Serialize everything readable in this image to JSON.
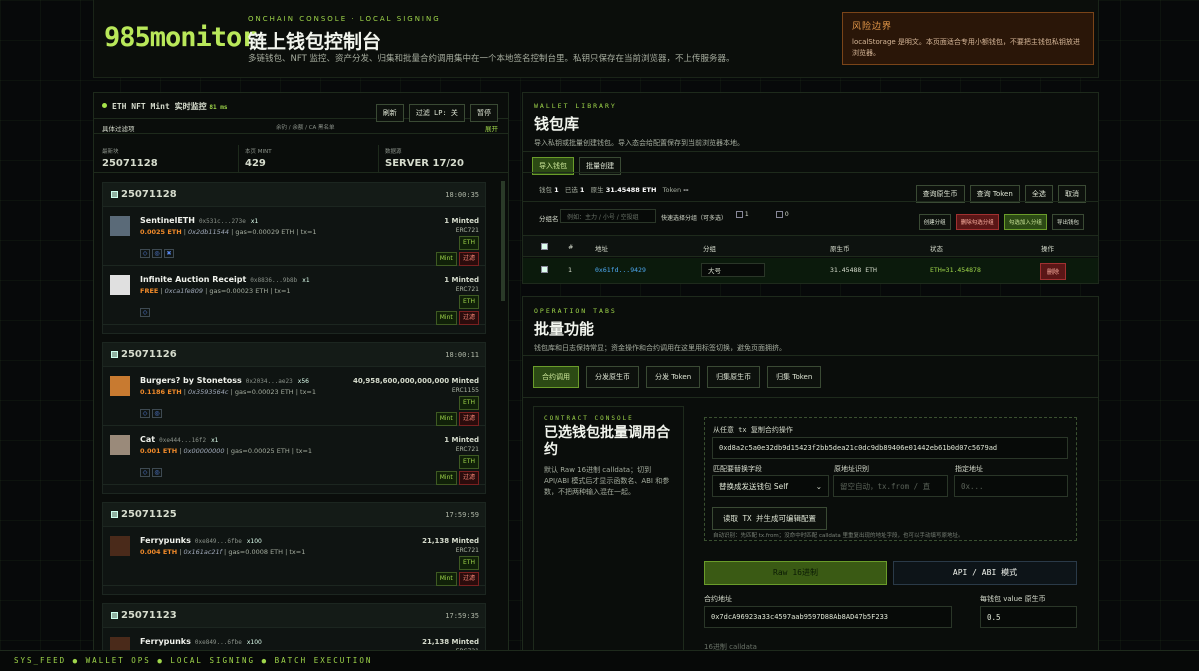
{
  "header": {
    "logo": "985monitor",
    "kicker": "ONCHAIN CONSOLE · LOCAL SIGNING",
    "title": "链上钱包控制台",
    "desc": "多链钱包、NFT 监控、资产分发、归集和批量合约调用集中在一个本地签名控制台里。私钥只保存在当前浏览器，不上传服务器。"
  },
  "risk": {
    "title": "风险边界",
    "desc": "localStorage 是明文。本页面适合专用小额钱包，不要把主钱包私钥放进浏览器。"
  },
  "monitor": {
    "title": "ETH NFT Mint 实时监控",
    "latency": "81 ms",
    "refresh": "刷新",
    "filter_lp": "过滤 LP: 关",
    "pause": "暂停",
    "filter_label": "具体过滤项",
    "filter_hint": "余钓 / 余额 / CA 黑名单",
    "expand": "展开",
    "stats": [
      {
        "k": "最新块",
        "v": "25071128"
      },
      {
        "k": "本页 MINT",
        "v": "429"
      },
      {
        "k": "数据源",
        "v": "SERVER 17/20"
      }
    ],
    "blocks": [
      {
        "num": "25071128",
        "time": "18:00:35",
        "items": [
          {
            "name": "SentinelETH",
            "contract": "0x531c...273e",
            "qty": "x1",
            "price": "0.0025 ETH",
            "from": "0x2db11544",
            "gas": "gas=0.00029 ETH",
            "tx": "tx=1",
            "minted": "1 Minted",
            "std": "ERC721",
            "chain": "ETH",
            "mint": "Mint",
            "block": "过滤",
            "icons": [
              "◇",
              "◎",
              "✖"
            ]
          },
          {
            "name": "Infinite Auction Receipt",
            "contract": "0x8836...9b8b",
            "qty": "x1",
            "price": "FREE",
            "from": "0xca1fe809",
            "gas": "gas=0.00023 ETH",
            "tx": "tx=1",
            "minted": "1 Minted",
            "std": "ERC721",
            "chain": "ETH",
            "mint": "Mint",
            "block": "过滤",
            "icons": [
              "◇"
            ]
          }
        ]
      },
      {
        "num": "25071126",
        "time": "18:00:11",
        "items": [
          {
            "name": "Burgers? by Stonetoss",
            "contract": "0x2034...ae23",
            "qty": "x56",
            "price": "0.1186 ETH",
            "from": "0x3593564c",
            "gas": "gas=0.00023 ETH",
            "tx": "tx=1",
            "minted": "40,958,600,000,000,000 Minted",
            "std": "ERC1155",
            "chain": "ETH",
            "mint": "Mint",
            "block": "过滤",
            "icons": [
              "◇",
              "◎"
            ]
          },
          {
            "name": "Cat",
            "contract": "0xe444...16f2",
            "qty": "x1",
            "price": "0.001 ETH",
            "from": "0x00000000",
            "gas": "gas=0.00025 ETH",
            "tx": "tx=1",
            "minted": "1 Minted",
            "std": "ERC721",
            "chain": "ETH",
            "mint": "Mint",
            "block": "过滤",
            "icons": [
              "◇",
              "◎"
            ]
          }
        ]
      },
      {
        "num": "25071125",
        "time": "17:59:59",
        "items": [
          {
            "name": "Ferrypunks",
            "contract": "0xe849...6fbe",
            "qty": "x100",
            "price": "0.004 ETH",
            "from": "0x161ac21f",
            "gas": "gas=0.0008 ETH",
            "tx": "tx=1",
            "minted": "21,138 Minted",
            "std": "ERC721",
            "chain": "ETH",
            "mint": "Mint",
            "block": "过滤",
            "icons": []
          }
        ]
      },
      {
        "num": "25071123",
        "time": "17:59:35",
        "items": [
          {
            "name": "Ferrypunks",
            "contract": "0xe849...6fbe",
            "qty": "x100",
            "price": "0.004 ETH",
            "from": "0x161ac21f",
            "gas": "gas=0.00076 ETH",
            "tx": "tx=1",
            "minted": "21,138 Minted",
            "std": "ERC721",
            "chain": "ETH",
            "mint": "Mint",
            "block": "过滤",
            "icons": []
          }
        ]
      }
    ]
  },
  "wallet": {
    "kicker": "WALLET LIBRARY",
    "title": "钱包库",
    "desc": "导入私钥或批量创建钱包。导入态会给配置保存到当前浏览器本地。",
    "import_btn": "导入钱包",
    "batch_btn": "批量创建",
    "summary": {
      "wallets_label": "钱包",
      "wallets": "1",
      "selected_label": "已选",
      "selected": "1",
      "native_label": "原生",
      "native": "31.45488 ETH",
      "token_label": "Token",
      "token": "--"
    },
    "query_native": "查询原生币",
    "query_token": "查询 Token",
    "select_all": "全选",
    "cancel": "取消",
    "group_label": "分组名",
    "group_placeholder": "例如：主力 / 小号 / 空投组",
    "group_select_label": "快速选择分组（可多选）",
    "chk1": "1",
    "chk2": "0",
    "create_group": "创建分组",
    "delete_group": "删除勾选分组",
    "add_to_group": "勾选加入分组",
    "export": "导出钱包",
    "cols": [
      "",
      "#",
      "地址",
      "分组",
      "原生币",
      "状态",
      "操作"
    ],
    "row": {
      "idx": "1",
      "address": "0x61fd...9429",
      "group": "大号",
      "native": "31.45488 ETH",
      "status": "ETH=31.454878",
      "action": "删除"
    }
  },
  "batch": {
    "kicker": "OPERATION TABS",
    "title": "批量功能",
    "desc": "钱包库和日志保持常显；资金操作和合约调用在这里用标签切换，避免页面拥挤。",
    "tabs": [
      "合约调用",
      "分发原生币",
      "分发 Token",
      "归集原生币",
      "归集 Token"
    ]
  },
  "contract": {
    "kicker": "CONTRACT CONSOLE",
    "title": "已选钱包批量调用合约",
    "desc": "默认 Raw 16进制 calldata；切到 API/ABI 模式后才显示函数名、ABI 和参数，不把两种输入混在一起。",
    "tx_label": "从任意 tx 复制合约操作",
    "tx_value": "0xd8a2c5a0e32db9d15423f2bb5dea21c0dc9db89406e01442eb61b0d07c5679ad",
    "match_label": "匹配要替换字段",
    "match_value": "替换成发送钱包 Self",
    "from_label": "原地址识别",
    "from_placeholder": "留空自动，tx.from / 直",
    "target_label": "指定地址",
    "target_placeholder": "0x...",
    "read_btn": "读取 TX 并生成可编辑配置",
    "hint": "自动识别：先匹配 tx.from；没命中时匹配 calldata 里重复出现的地址字段，也可以手动填写原地址。",
    "mode_raw": "Raw 16进制",
    "mode_api": "API / ABI 模式",
    "addr_label": "合约地址",
    "addr_value": "0x7dcA96923a33c4597aab9597D88Ab8AD47b5F233",
    "value_label": "每钱包 value 原生币",
    "value_value": "0.5",
    "calldata_label": "16进制 calldata"
  },
  "footer": "SYS_FEED ● WALLET OPS ● LOCAL SIGNING ● BATCH EXECUTION",
  "colors": {
    "accent": "#9fd64a",
    "price": "#f08a2a",
    "danger": "#ff8a7a"
  }
}
